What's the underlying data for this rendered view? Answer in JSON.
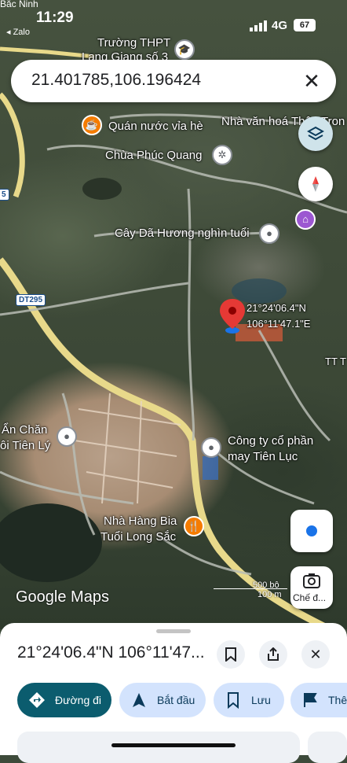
{
  "status_bar": {
    "time": "11:29",
    "back_app_top": "Bắc Ninh",
    "back_app": "◂ Zalo",
    "network": "4G",
    "battery": "67"
  },
  "search": {
    "query": "21.401785,106.196424",
    "close_icon": "close-icon"
  },
  "map": {
    "labels": {
      "school": "Trường THPT",
      "school2": "Lạng Giang số 3",
      "cafe": "Quán nước vỉa hè",
      "culture_house": "Nhà văn hoá Thôn Tron",
      "pagoda": "Chùa Phúc Quang",
      "tree": "Cây Dã Hương nghìn tuổi",
      "pin_lat": "21°24'06.4\"N",
      "pin_lon": "106°11'47.1\"E",
      "right_edge": "TT T",
      "company1": "Công ty cổ phần",
      "company2": "may Tiên Lục",
      "left_poi1": "Ẩn Chăn",
      "left_poi2": "ôi Tiên Lý",
      "restaurant1": "Nhà Hàng Bia",
      "restaurant2": "Tuổi Long Sắc",
      "road_shield": "DT295",
      "left_shield": "5",
      "watermark": "Google Maps",
      "scale1": "500 bộ",
      "scale2": "100 m"
    },
    "buttons": {
      "layers": "layers-icon",
      "compass": "compass-icon",
      "location": "my-location-icon",
      "lens": "Chế đ..."
    }
  },
  "sheet": {
    "title": "21°24'06.4\"N 106°11'47...",
    "actions": [
      {
        "label": "Đường đi",
        "icon": "directions-icon"
      },
      {
        "label": "Bắt đầu",
        "icon": "navigation-arrow-icon"
      },
      {
        "label": "Lưu",
        "icon": "bookmark-icon"
      },
      {
        "label": "Thê",
        "icon": "flag-icon"
      }
    ]
  }
}
